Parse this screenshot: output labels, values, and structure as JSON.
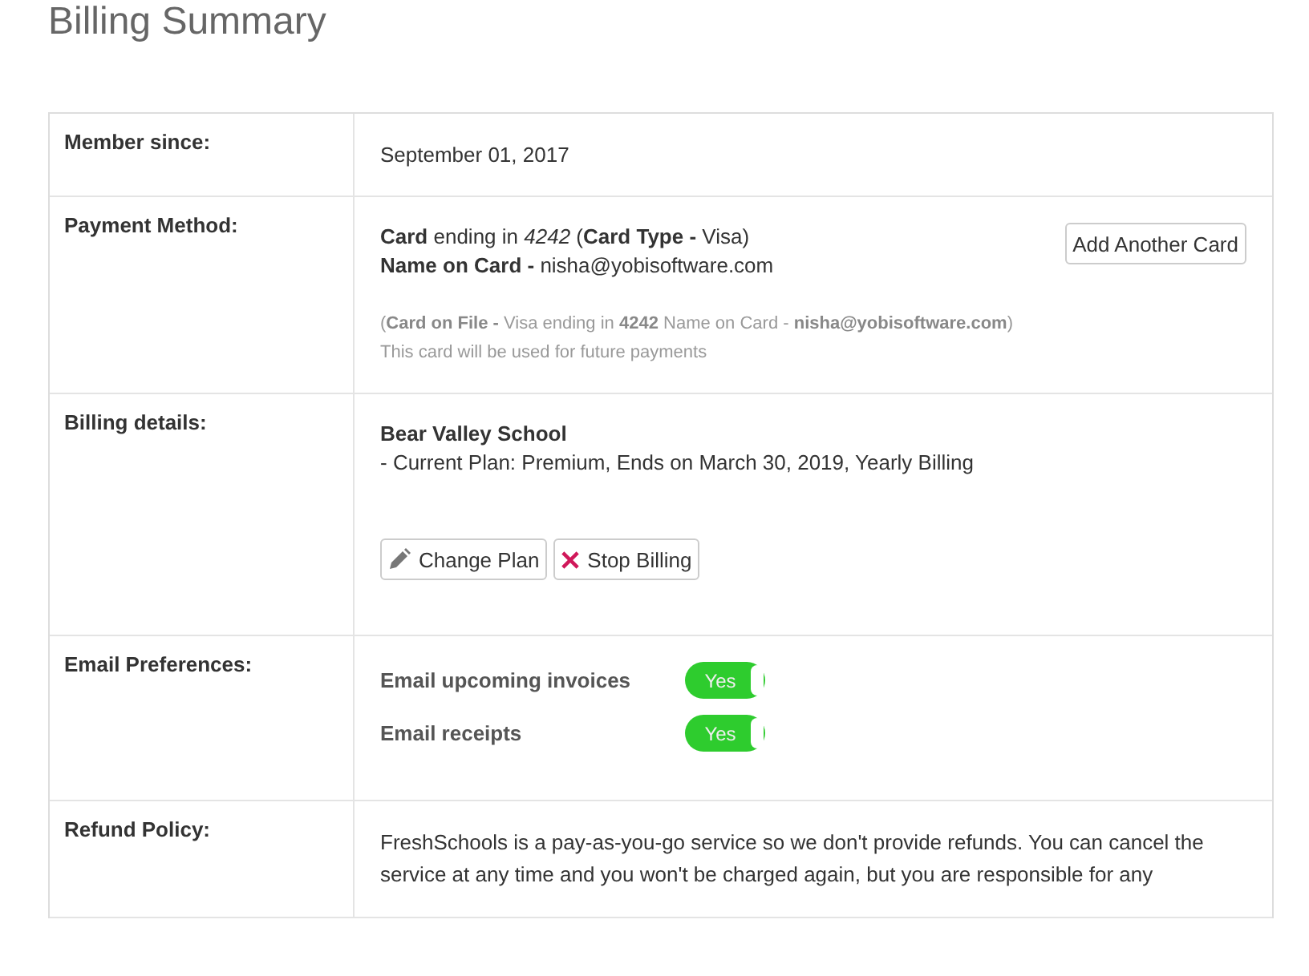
{
  "title": "Billing Summary",
  "rows": [
    {
      "kind": "text",
      "label": "Member since:",
      "value": "September 01, 2017"
    },
    {
      "kind": "payment",
      "label": "Payment Method:",
      "card_line": "**Card** ending in *4242* (**Card Type -** Visa)",
      "name_line": "**Name on Card -** nisha@yobisoftware.com",
      "file_line": "(**Card on File -** Visa ending in **4242** Name on Card - **nisha@yobisoftware.com**)",
      "note": "This card will be used for future payments",
      "button": "Add Another Card"
    },
    {
      "kind": "billing",
      "label": "Billing details:",
      "school": "Bear Valley School",
      "plan": "- Current Plan: Premium, Ends on March 30, 2019, Yearly Billing",
      "buttons": [
        {
          "kind": "edit",
          "label": "Change Plan"
        },
        {
          "kind": "stop",
          "label": "Stop Billing"
        }
      ]
    },
    {
      "kind": "prefs",
      "label": "Email Preferences:",
      "prefs": [
        {
          "label": "Email upcoming invoices",
          "on": true,
          "text": "Yes"
        },
        {
          "label": "Email receipts",
          "on": true,
          "text": "Yes"
        }
      ]
    },
    {
      "kind": "text",
      "label": "Refund Policy:",
      "value": "FreshSchools is a pay-as-you-go service so we don't provide refunds. You can cancel the service at any time and you won't be charged again, but you are responsible for any"
    }
  ]
}
